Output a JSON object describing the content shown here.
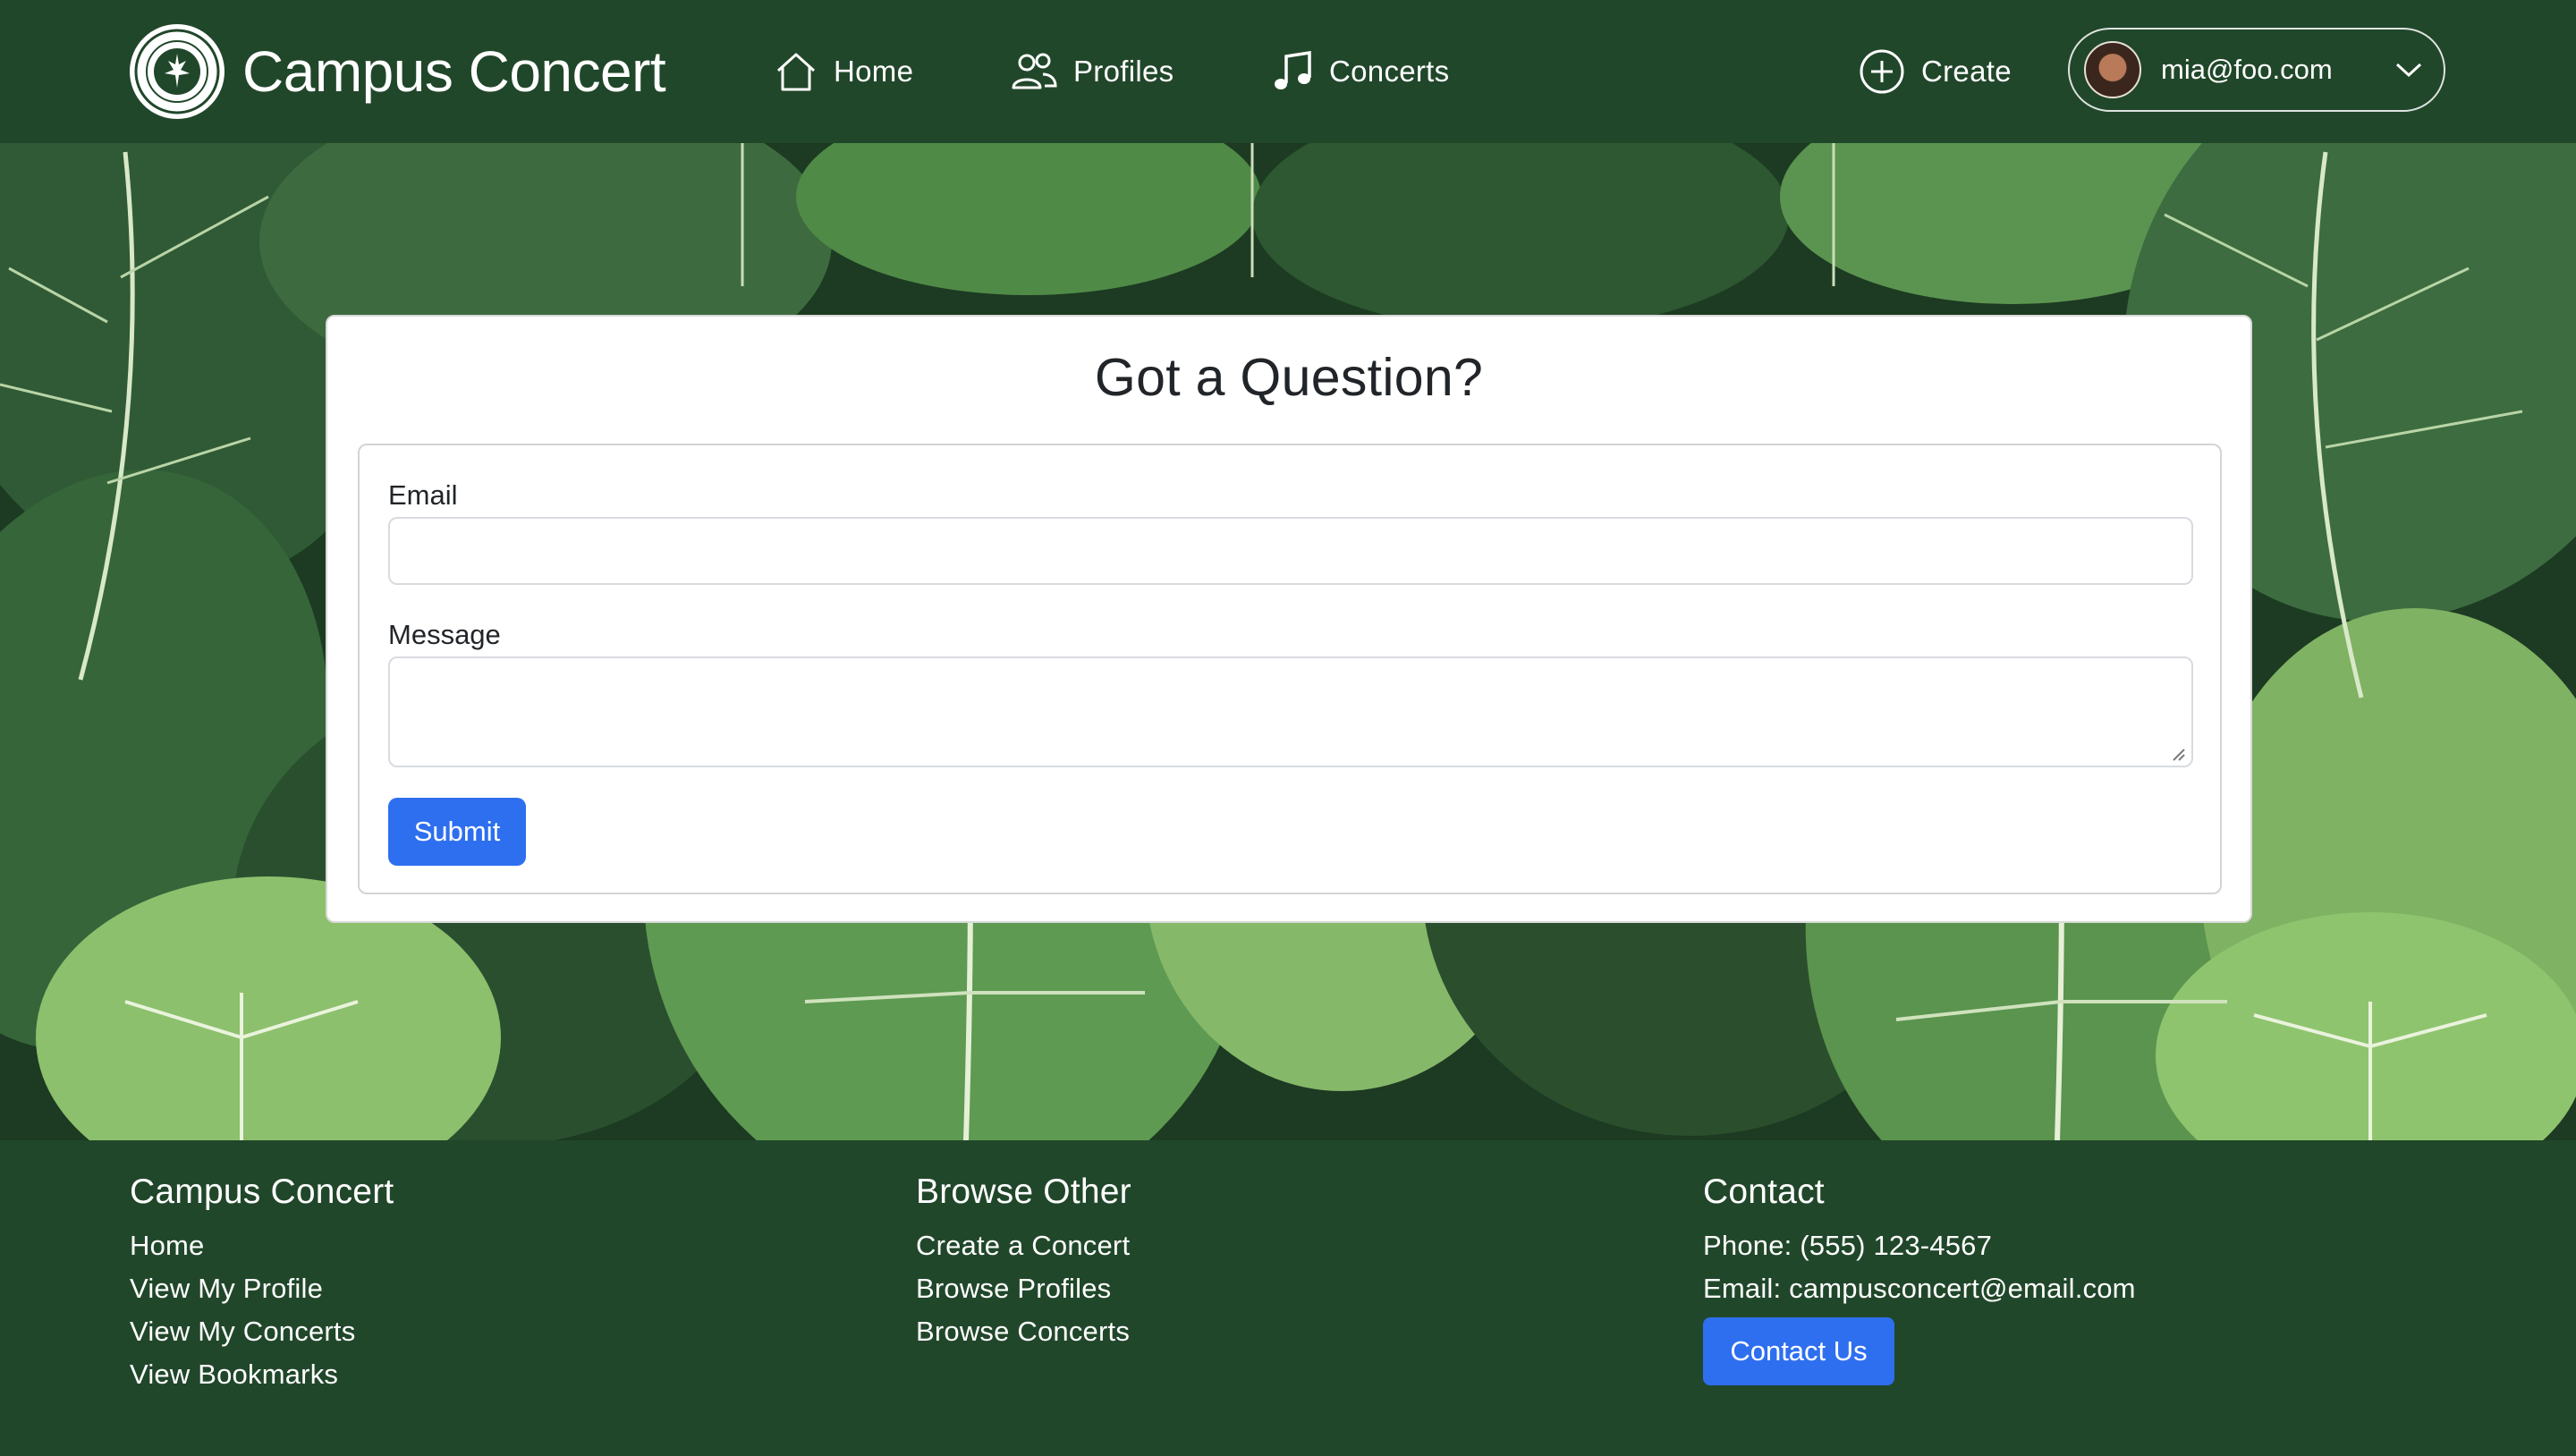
{
  "navbar": {
    "brand": "Campus Concert",
    "links": [
      {
        "label": "Home",
        "icon": "home-icon"
      },
      {
        "label": "Profiles",
        "icon": "people-icon"
      },
      {
        "label": "Concerts",
        "icon": "music-note-icon"
      }
    ],
    "create_label": "Create",
    "user_email": "mia@foo.com"
  },
  "form": {
    "title": "Got a Question?",
    "email_label": "Email",
    "email_value": "",
    "message_label": "Message",
    "message_value": "",
    "submit_label": "Submit"
  },
  "footer": {
    "col1": {
      "heading": "Campus Concert",
      "links": [
        "Home",
        "View My Profile",
        "View My Concerts",
        "View Bookmarks"
      ]
    },
    "col2": {
      "heading": "Browse Other",
      "links": [
        "Create a Concert",
        "Browse Profiles",
        "Browse Concerts"
      ]
    },
    "col3": {
      "heading": "Contact",
      "phone": "Phone: (555) 123-4567",
      "email": "Email: campusconcert@email.com",
      "button_label": "Contact Us"
    }
  },
  "colors": {
    "nav_bg": "#21472a",
    "button": "#2e6ff0",
    "text_dark": "#212529"
  }
}
